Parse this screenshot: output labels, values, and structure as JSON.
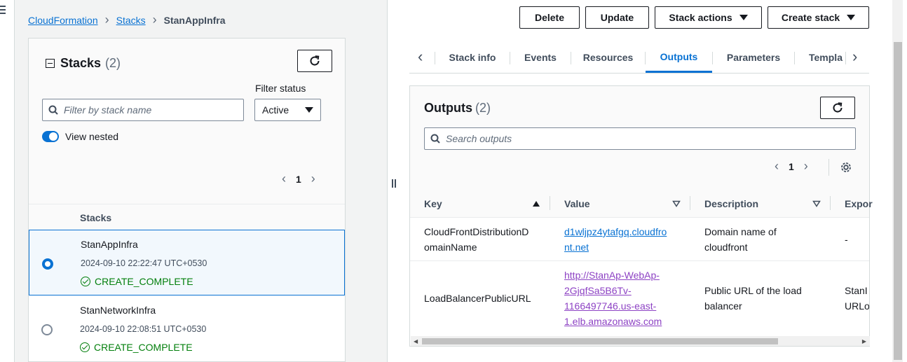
{
  "breadcrumb": {
    "items": [
      "CloudFormation",
      "Stacks"
    ],
    "current": "StanAppInfra"
  },
  "stacks_panel": {
    "title": "Stacks",
    "count": "(2)",
    "filter_label": "Filter status",
    "search_placeholder": "Filter by stack name",
    "filter_value": "Active",
    "toggle_label": "View nested",
    "page": "1",
    "column_header": "Stacks",
    "rows": [
      {
        "name": "StanAppInfra",
        "date": "2024-09-10 22:22:47 UTC+0530",
        "status": "CREATE_COMPLETE",
        "selected": true
      },
      {
        "name": "StanNetworkInfra",
        "date": "2024-09-10 22:08:51 UTC+0530",
        "status": "CREATE_COMPLETE",
        "selected": false
      }
    ]
  },
  "toolbar": {
    "delete": "Delete",
    "update": "Update",
    "stack_actions": "Stack actions",
    "create_stack": "Create stack"
  },
  "tabs": [
    "Stack info",
    "Events",
    "Resources",
    "Outputs",
    "Parameters",
    "Templa"
  ],
  "active_tab": "Outputs",
  "outputs": {
    "title": "Outputs",
    "count": "(2)",
    "search_placeholder": "Search outputs",
    "page": "1",
    "columns": [
      "Key",
      "Value",
      "Description",
      "Expor"
    ],
    "rows": [
      {
        "key_lines": [
          "CloudFrontDistributionD",
          "omainName"
        ],
        "value_lines": [
          "d1wljpz4ytafgq.cloudfro",
          "nt.net"
        ],
        "desc_lines": [
          "Domain name of",
          "cloudfront"
        ],
        "export_lines": [
          "-"
        ]
      },
      {
        "key_lines": [
          "LoadBalancerPublicURL"
        ],
        "value_lines": [
          "http://StanAp-WebAp-",
          "2GjqfSa5B6Tv-",
          "1166497746.us-east-",
          "1.elb.amazonaws.com"
        ],
        "desc_lines": [
          "Public URL of the load",
          "balancer"
        ],
        "export_lines": [
          "StanI",
          "URLo"
        ]
      }
    ]
  },
  "colors": {
    "link": "#0972d3",
    "visited_link": "#8d42c4",
    "success": "#037f0c",
    "active_tab": "#0972d3"
  },
  "icons": [
    "menu-icon",
    "refresh-icon",
    "search-icon",
    "caret-down-icon",
    "chevron-left-icon",
    "chevron-right-icon",
    "gear-icon",
    "check-circle-icon",
    "sort-asc-icon",
    "sort-icon"
  ]
}
